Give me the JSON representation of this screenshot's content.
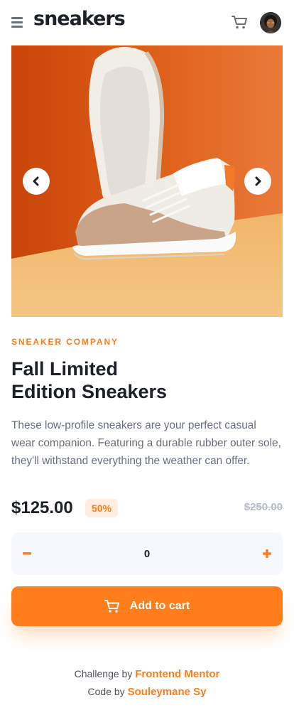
{
  "header": {
    "logo": "sneakers",
    "icons": {
      "menu": "menu-icon",
      "cart": "cart-icon",
      "avatar": "avatar"
    }
  },
  "product": {
    "company": "SNEAKER COMPANY",
    "title_line1": "Fall Limited",
    "title_line2": "Edition Sneakers",
    "description": "These low-profile sneakers are your perfect casual wear companion. Featuring a durable rubber outer sole, they'll withstand everything the weather can offer.",
    "price": "$125.00",
    "discount": "50%",
    "old_price": "$250.00"
  },
  "gallery": {
    "prev_icon": "chevron-left-icon",
    "next_icon": "chevron-right-icon"
  },
  "cart": {
    "minus": "−",
    "quantity": "0",
    "plus": "+",
    "add_label": "Add to cart"
  },
  "footer": {
    "challenge_prefix": "Challenge by",
    "challenge_link": "Frontend Mentor",
    "code_prefix": "Code by",
    "code_link": "Souleymane Sy"
  },
  "colors": {
    "accent": "#ff7d1a",
    "accent_pale": "#ffede0",
    "text_dark": "#1d2026",
    "text_gray": "#69707d",
    "muted": "#b6bcc8",
    "qty_bg": "#f6f8fd"
  }
}
